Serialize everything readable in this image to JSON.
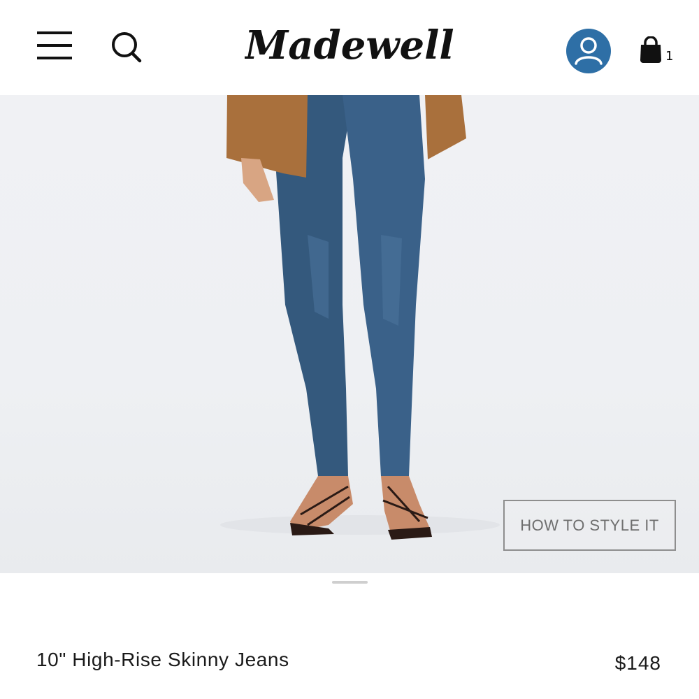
{
  "header": {
    "brand": "Madewell",
    "bag_count": "1"
  },
  "hero": {
    "style_button_label": "HOW TO STYLE IT"
  },
  "product": {
    "title": "10\" High-Rise Skinny Jeans",
    "price": "$148"
  },
  "colors": {
    "account_blue": "#2e6fa6",
    "jacket_brown": "#a9703c",
    "denim_blue": "#34597d"
  },
  "icons": [
    "hamburger-menu-icon",
    "search-icon",
    "user-icon",
    "shopping-bag-icon"
  ]
}
